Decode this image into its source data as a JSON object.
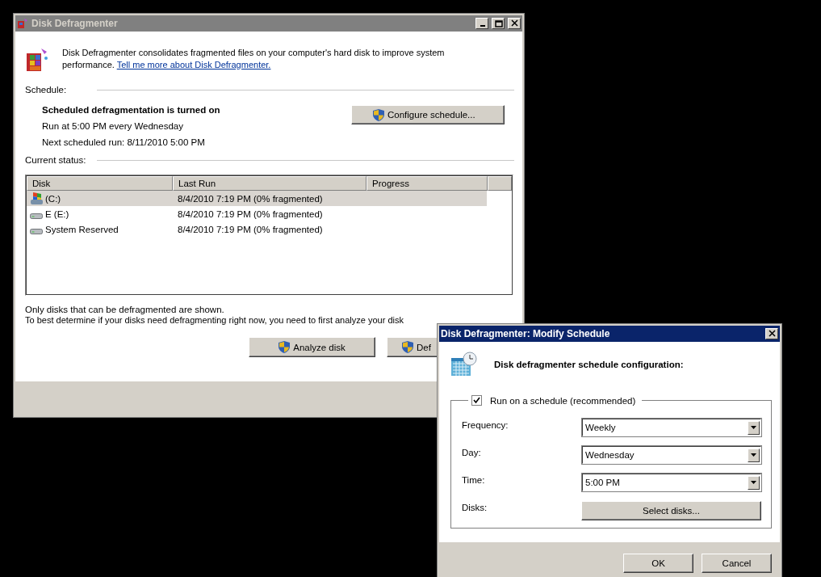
{
  "main_window": {
    "title": "Disk Defragmenter",
    "description": "Disk Defragmenter consolidates fragmented files on your computer's hard disk to improve system performance.",
    "link": "Tell me more about Disk Defragmenter.",
    "schedule": {
      "heading": "Schedule:",
      "status": "Scheduled defragmentation is turned on",
      "run_at": "Run at 5:00 PM every Wednesday",
      "next_run": "Next scheduled run: 8/11/2010 5:00 PM",
      "button": "Configure schedule..."
    },
    "current_status": {
      "heading": "Current status:",
      "table": {
        "columns": [
          "Disk",
          "Last Run",
          "Progress"
        ],
        "rows": [
          {
            "disk": "(C:)",
            "kind": "system",
            "last_run": "8/4/2010 7:19 PM (0% fragmented)",
            "selected": true
          },
          {
            "disk": "E (E:)",
            "kind": "drive",
            "last_run": "8/4/2010 7:19 PM (0% fragmented)",
            "selected": false
          },
          {
            "disk": "System Reserved",
            "kind": "drive",
            "last_run": "8/4/2010 7:19 PM (0% fragmented)",
            "selected": false
          }
        ]
      }
    },
    "notes": [
      "Only disks that can be defragmented are shown.",
      "To best determine if your disks need defragmenting right now, you need to first analyze your disk"
    ],
    "buttons": [
      "Analyze disk",
      "Def"
    ]
  },
  "schedule_dialog": {
    "title": "Disk Defragmenter: Modify Schedule",
    "heading": "Disk defragmenter schedule configuration:",
    "run_on_schedule": {
      "label": "Run on a schedule (recommended)",
      "checked": true
    },
    "fields": [
      {
        "label": "Frequency:",
        "kind": "select",
        "value": "Weekly"
      },
      {
        "label": "Day:",
        "kind": "select",
        "value": "Wednesday"
      },
      {
        "label": "Time:",
        "kind": "select",
        "value": "5:00 PM"
      },
      {
        "label": "Disks:",
        "kind": "button",
        "value": "Select disks..."
      }
    ],
    "buttons": [
      "OK",
      "Cancel"
    ]
  }
}
